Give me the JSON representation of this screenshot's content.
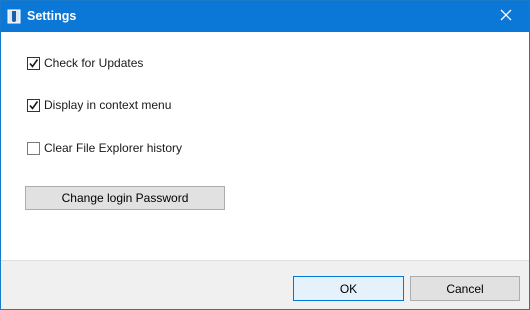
{
  "window": {
    "title": "Settings",
    "icon": "settings-app-icon",
    "close_icon": "close-icon"
  },
  "options": [
    {
      "label": "Check for Updates",
      "checked": true
    },
    {
      "label": "Display in context menu",
      "checked": true
    },
    {
      "label": "Clear File Explorer history",
      "checked": false
    }
  ],
  "change_password_label": "Change login Password",
  "footer": {
    "ok_label": "OK",
    "cancel_label": "Cancel"
  },
  "colors": {
    "titlebar": "#0b78d7",
    "accent_border": "#0078d7",
    "footer_bg": "#f0f0f0",
    "button_bg": "#e1e1e1"
  }
}
